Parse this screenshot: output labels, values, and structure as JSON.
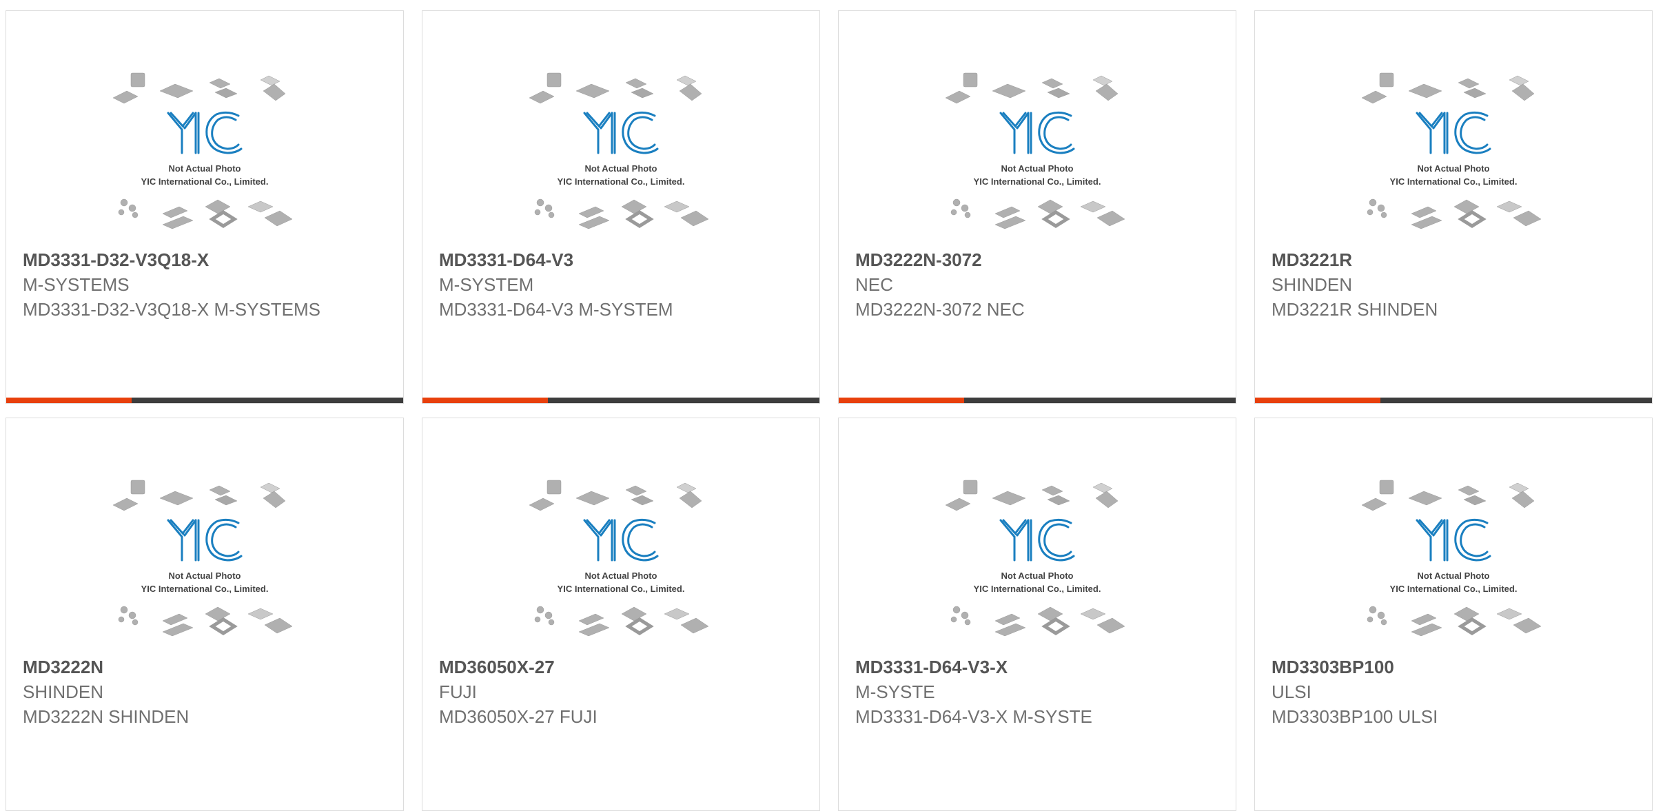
{
  "colors": {
    "accent": "#e8400c",
    "bar": "#3d3d3d",
    "logo_blue": "#1a7fc0",
    "part_text": "#555555",
    "sub_text": "#707070"
  },
  "placeholder": {
    "line1": "Not Actual Photo",
    "line2": "YIC International Co., Limited.",
    "logo_text": "YIC"
  },
  "products": [
    {
      "part": "MD3331-D32-V3Q18-X",
      "maker": "M-SYSTEMS",
      "desc": "MD3331-D32-V3Q18-X M-SYSTEMS",
      "has_bar": true
    },
    {
      "part": "MD3331-D64-V3",
      "maker": "M-SYSTEM",
      "desc": "MD3331-D64-V3 M-SYSTEM",
      "has_bar": true
    },
    {
      "part": "MD3222N-3072",
      "maker": "NEC",
      "desc": "MD3222N-3072 NEC",
      "has_bar": true
    },
    {
      "part": "MD3221R",
      "maker": "SHINDEN",
      "desc": "MD3221R SHINDEN",
      "has_bar": true
    },
    {
      "part": "MD3222N",
      "maker": "SHINDEN",
      "desc": "MD3222N SHINDEN",
      "has_bar": false
    },
    {
      "part": "MD36050X-27",
      "maker": "FUJI",
      "desc": "MD36050X-27 FUJI",
      "has_bar": false
    },
    {
      "part": "MD3331-D64-V3-X",
      "maker": "M-SYSTE",
      "desc": "MD3331-D64-V3-X M-SYSTE",
      "has_bar": false
    },
    {
      "part": "MD3303BP100",
      "maker": "ULSI",
      "desc": "MD3303BP100 ULSI",
      "has_bar": false
    }
  ]
}
